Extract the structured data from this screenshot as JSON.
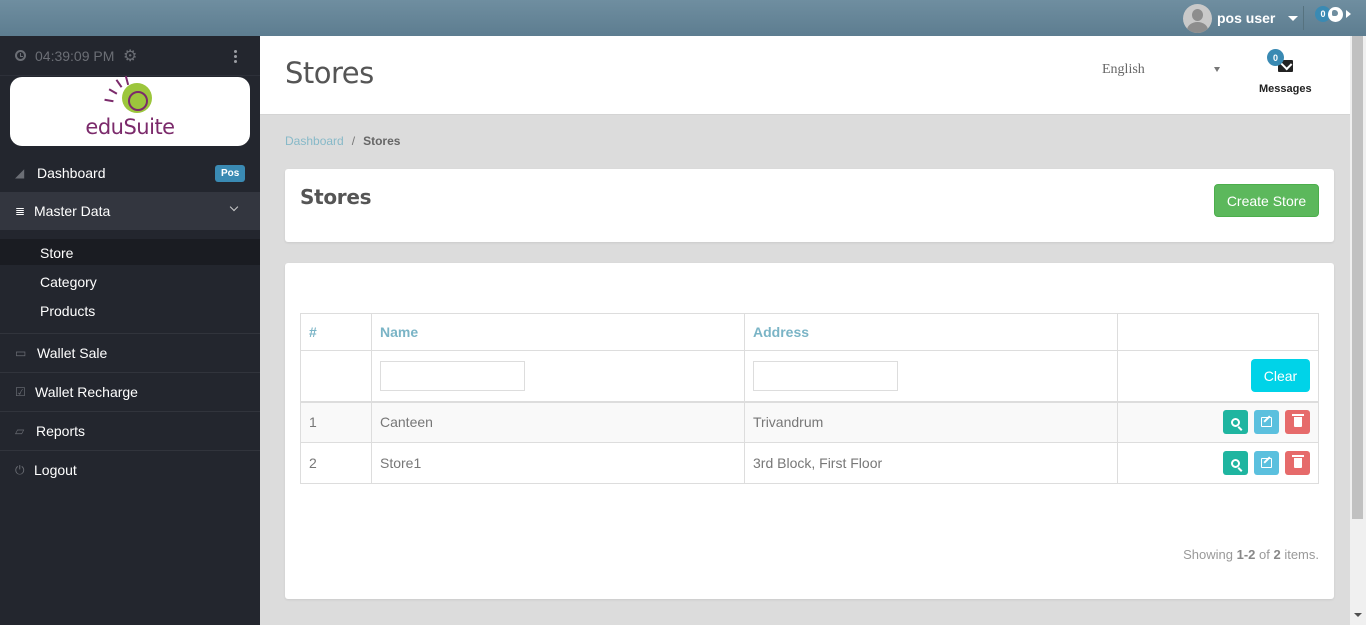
{
  "topbar": {
    "user_name": "pos user",
    "notification_count": "0"
  },
  "sidebar": {
    "clock": "04:39:09 PM",
    "logo_text": "eduSuite",
    "items": [
      {
        "label": "Dashboard",
        "icon": "area-chart-icon",
        "badge": "Pos"
      },
      {
        "label": "Master Data",
        "icon": "database-icon",
        "expanded": true
      },
      {
        "label": "Wallet Sale",
        "icon": "money-icon"
      },
      {
        "label": "Wallet Recharge",
        "icon": "check-square-icon"
      },
      {
        "label": "Reports",
        "icon": "folder-open-icon"
      },
      {
        "label": "Logout",
        "icon": "power-icon"
      }
    ],
    "sub_items": [
      {
        "label": "Store",
        "active": true
      },
      {
        "label": "Category"
      },
      {
        "label": "Products"
      }
    ]
  },
  "header": {
    "title": "Stores",
    "language": "English",
    "messages_label": "Messages",
    "messages_count": "0"
  },
  "breadcrumb": {
    "items": [
      "Dashboard",
      "Stores"
    ],
    "separator": "/"
  },
  "panel": {
    "title": "Stores",
    "create_label": "Create Store"
  },
  "table": {
    "columns": [
      "#",
      "Name",
      "Address",
      ""
    ],
    "filters": {
      "name": "",
      "address": ""
    },
    "clear_label": "Clear",
    "rows": [
      {
        "num": "1",
        "name": "Canteen",
        "address": "Trivandrum"
      },
      {
        "num": "2",
        "name": "Store1",
        "address": "3rd Block, First Floor"
      }
    ],
    "summary": {
      "prefix": "Showing ",
      "range": "1-2",
      "mid": " of ",
      "total": "2",
      "suffix": " items."
    }
  },
  "colors": {
    "topbar": "#6f8ea0",
    "sidebar": "#23262e",
    "primary_badge": "#3a8ab3",
    "create_button": "#5cb85c",
    "clear_button": "#00d3e8",
    "view_button": "#1fb5a0",
    "edit_button": "#5bc0de",
    "delete_button": "#e66b6b"
  }
}
